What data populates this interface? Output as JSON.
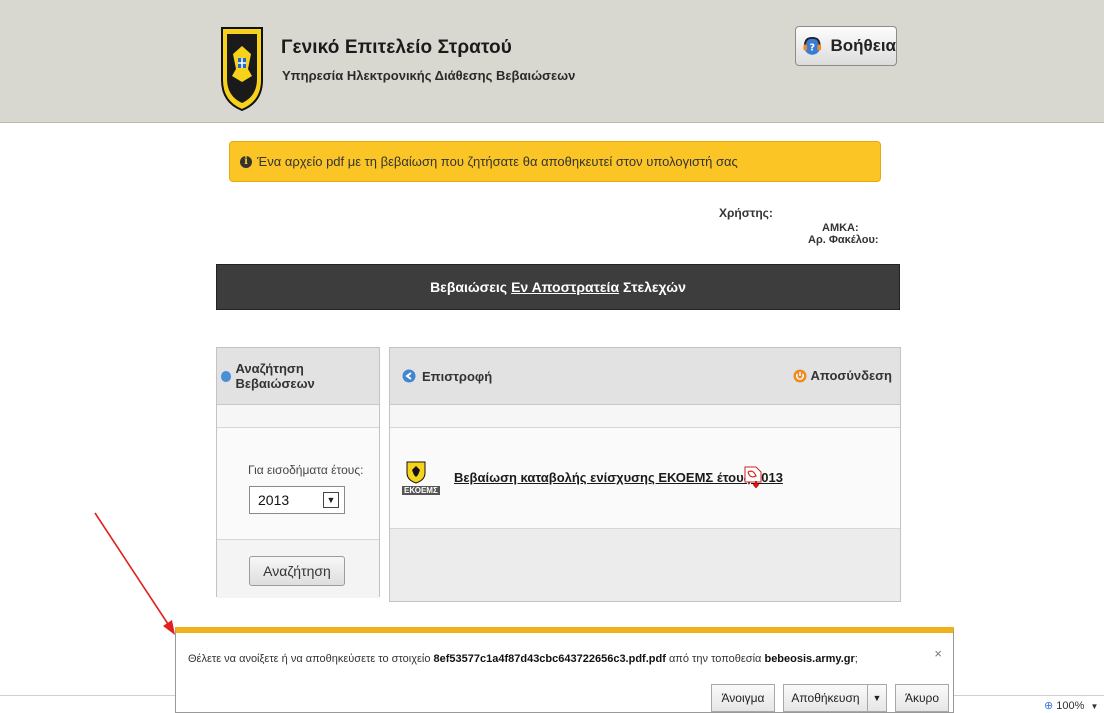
{
  "header": {
    "title": "Γενικό Επιτελείο Στρατού",
    "subtitle": "Υπηρεσία Ηλεκτρονικής Διάθεσης Βεβαιώσεων",
    "help_label": "Βοήθεια"
  },
  "notice": {
    "text": "Ένα αρχείο pdf με τη βεβαίωση που ζητήσατε θα αποθηκευτεί στον υπολογιστή σας"
  },
  "user_info": {
    "user_label": "Χρήστης:",
    "amka_label": "ΑΜΚΑ:",
    "folder_label": "Αρ. Φακέλου:"
  },
  "banner": {
    "part1": "Βεβαιώσεις",
    "part2": "Εν Αποστρατεία",
    "part3": "Στελεχών"
  },
  "search_panel": {
    "title": "Αναζήτηση Βεβαιώσεων",
    "year_label": "Για εισοδήματα έτους:",
    "year_value": "2013",
    "search_button": "Αναζήτηση"
  },
  "results_panel": {
    "back_label": "Επιστροφή",
    "logout_label": "Αποσύνδεση",
    "certificate_link": "Βεβαίωση καταβολής ενίσχυσης ΕΚΟΕΜΣ έτους 2013",
    "badge": "ΕΚΟΕΜΣ"
  },
  "download_bar": {
    "text_prefix": "Θέλετε να ανοίξετε ή να αποθηκεύσετε το στοιχείο",
    "filename": "8ef53577c1a4f87d43cbc643722656c3.pdf.pdf",
    "text_middle": "από την τοποθεσία",
    "site": "bebeosis.army.gr",
    "text_suffix": ";",
    "close": "×",
    "open_button": "Άνοιγμα",
    "save_button": "Αποθήκευση",
    "save_dropdown": "▼",
    "cancel_button": "Άκυρο"
  },
  "status": {
    "zoom": "100%"
  },
  "colors": {
    "header_bg": "#d8d8d0",
    "notice_bg": "#fbc625",
    "banner_bg": "#3d3d3d",
    "download_accent": "#f0b21b",
    "arrow": "#e02020"
  }
}
